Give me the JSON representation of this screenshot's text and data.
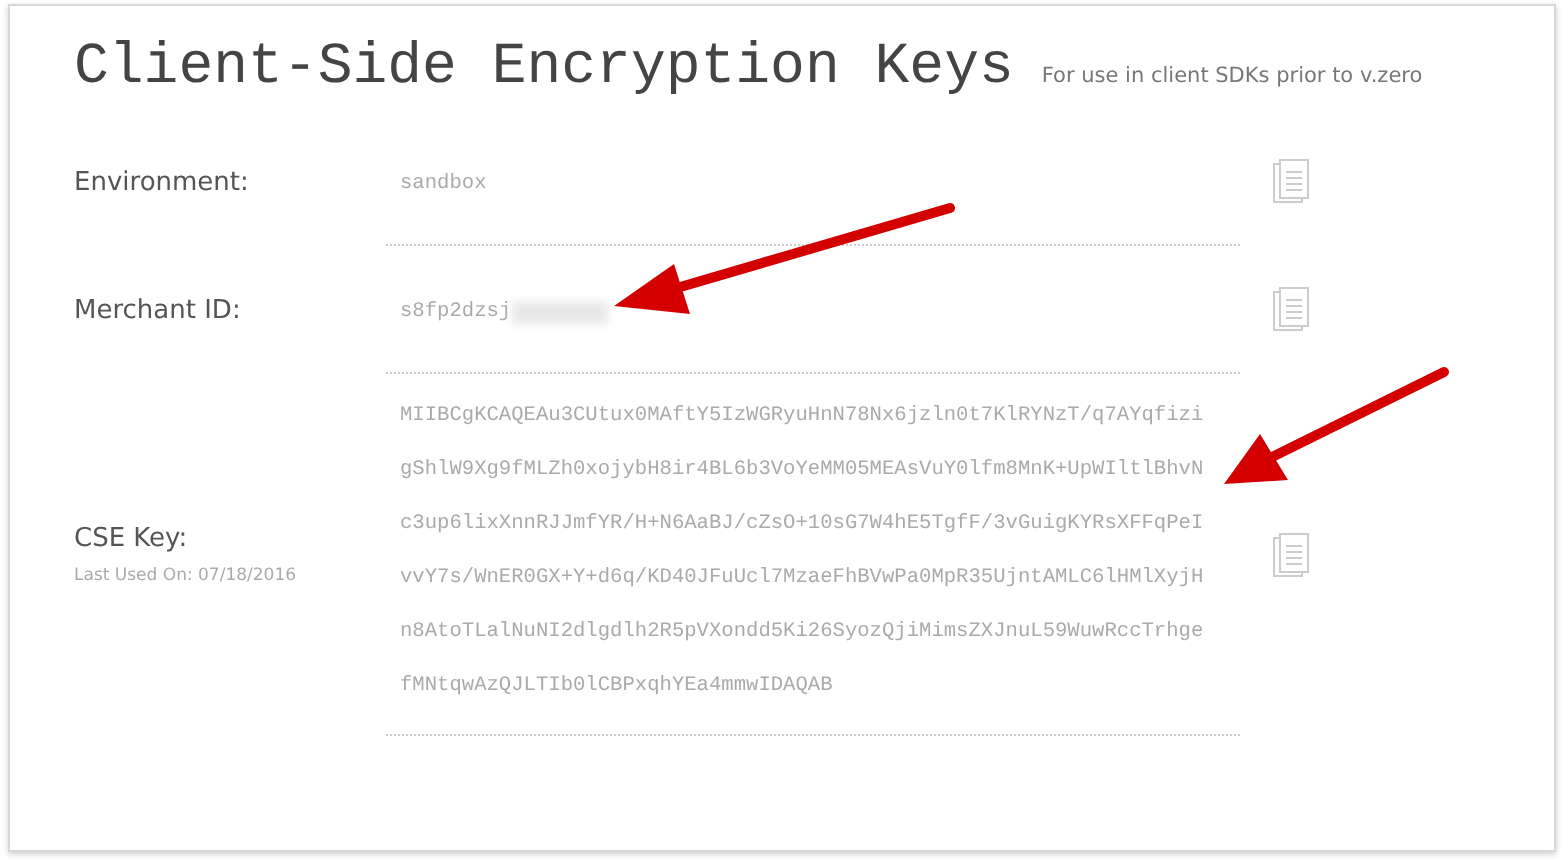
{
  "title": "Client-Side Encryption Keys",
  "subtitle": "For use in client SDKs prior to v.zero",
  "fields": [
    {
      "label": "Environment:",
      "value": [
        "sandbox"
      ],
      "redacted": false
    },
    {
      "label": "Merchant ID:",
      "value": [
        "s8fp2dzsj"
      ],
      "redacted": true
    },
    {
      "label": "CSE Key:",
      "note": "Last Used On: 07/18/2016",
      "value": [
        "MIIBCgKCAQEAu3CUtux0MAftY5IzWGRyuHnN78Nx6jzln0t7KlRYNzT/q7AYqfizi",
        "gShlW9Xg9fMLZh0xojybH8ir4BL6b3VoYeMM05MEAsVuY0lfm8MnK+UpWIltlBhvN",
        "c3up6lixXnnRJJmfYR/H+N6AaBJ/cZsO+10sG7W4hE5TgfF/3vGuigKYRsXFFqPeI",
        "vvY7s/WnER0GX+Y+d6q/KD40JFuUcl7MzaeFhBVwPa0MpR35UjntAMLC6lHMlXyjH",
        "n8AtoTLalNuNI2dlgdlh2R5pVXondd5Ki26SyozQjiMimsZXJnuL59WuwRccTrhge",
        "fMNtqwAzQJLTIb0lCBPxqhYEa4mmwIDAQAB"
      ],
      "redacted": false
    }
  ]
}
